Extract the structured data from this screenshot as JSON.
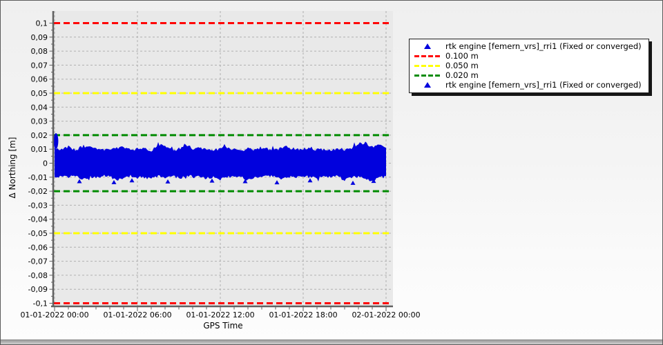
{
  "window": {
    "background_top": "#efefef",
    "background_bottom": "#fdfdfd",
    "plot_background": "#e9e9e9",
    "grid_color": "#b0b0b0",
    "axis_color": "#606060",
    "text_color": "#000000"
  },
  "chart_data": {
    "type": "scatter",
    "title": "",
    "xlabel": "GPS Time",
    "ylabel": "Δ Northing [m]",
    "grid": true,
    "legend_position": "right-top",
    "x_range_hours": [
      0,
      24
    ],
    "x_minor_tick_hours": 1,
    "x_ticks": [
      {
        "hours": 0,
        "label": "01-01-2022 00:00"
      },
      {
        "hours": 6,
        "label": "01-01-2022 06:00"
      },
      {
        "hours": 12,
        "label": "01-01-2022 12:00"
      },
      {
        "hours": 18,
        "label": "01-01-2022 18:00"
      },
      {
        "hours": 24,
        "label": "02-01-2022 00:00"
      }
    ],
    "y_min": -0.1,
    "y_max": 0.1,
    "y_tick_step": 0.01,
    "y_minor_tick_step": 0.005,
    "y_tick_labels": [
      "0,1",
      "0,09",
      "0,08",
      "0,07",
      "0,06",
      "0,05",
      "0,04",
      "0,03",
      "0,02",
      "0,01",
      "0",
      "-0,01",
      "-0,02",
      "-0,03",
      "-0,04",
      "-0,05",
      "-0,06",
      "-0,07",
      "-0,08",
      "-0,09",
      "-0,1"
    ],
    "reference_lines": [
      {
        "value": 0.1,
        "color": "#ff0000",
        "label": "0.100 m"
      },
      {
        "value": -0.1,
        "color": "#ff0000",
        "label": "0.100 m"
      },
      {
        "value": 0.05,
        "color": "#ffff00",
        "label": "0.050 m"
      },
      {
        "value": -0.05,
        "color": "#ffff00",
        "label": "0.050 m"
      },
      {
        "value": 0.02,
        "color": "#008b00",
        "label": "0.020 m"
      },
      {
        "value": -0.02,
        "color": "#008b00",
        "label": "0.020 m"
      }
    ],
    "series": [
      {
        "name": "rtk engine [femern_vrs]_rri1 (Fixed or converged)",
        "marker": "triangle",
        "color": "#0101dd",
        "band": {
          "x_start_hours": 0,
          "x_step_hours": 0.5,
          "upper": [
            0.0105,
            0.01,
            0.0118,
            0.0095,
            0.0102,
            0.0125,
            0.0108,
            0.0098,
            0.0092,
            0.0105,
            0.0112,
            0.0095,
            0.01,
            0.0108,
            0.009,
            0.0135,
            0.0115,
            0.01,
            0.0095,
            0.013,
            0.0098,
            0.011,
            0.0102,
            0.0092,
            0.0105,
            0.0112,
            0.0098,
            0.009,
            0.0104,
            0.0096,
            0.0108,
            0.01,
            0.0095,
            0.0112,
            0.0105,
            0.0098,
            0.0102,
            0.011,
            0.0095,
            0.01,
            0.0092,
            0.0105,
            0.0098,
            0.011,
            0.014,
            0.0142,
            0.0118,
            0.0125,
            0.011
          ],
          "lower": [
            -0.0105,
            -0.0095,
            -0.01,
            -0.0092,
            -0.0118,
            -0.0098,
            -0.0105,
            -0.009,
            -0.0095,
            -0.0125,
            -0.01,
            -0.0092,
            -0.0098,
            -0.0105,
            -0.011,
            -0.0095,
            -0.01,
            -0.009,
            -0.0105,
            -0.0098,
            -0.0092,
            -0.01,
            -0.0108,
            -0.0095,
            -0.0115,
            -0.0098,
            -0.0092,
            -0.01,
            -0.012,
            -0.0095,
            -0.01,
            -0.009,
            -0.0098,
            -0.011,
            -0.0095,
            -0.0102,
            -0.0092,
            -0.01,
            -0.0105,
            -0.0095,
            -0.0098,
            -0.009,
            -0.0125,
            -0.01,
            -0.0095,
            -0.0105,
            -0.013,
            -0.0098,
            -0.01
          ]
        },
        "startup_cluster": {
          "hours_center": 0.1,
          "hours_radius": 0.17,
          "value_center": 0.0158,
          "value_radius": 0.0056
        },
        "outliers": [
          [
            1.8,
            -0.0128
          ],
          [
            4.3,
            -0.0135
          ],
          [
            5.6,
            -0.0122
          ],
          [
            8.2,
            -0.013
          ],
          [
            11.4,
            -0.0124
          ],
          [
            13.8,
            -0.0128
          ],
          [
            16.1,
            -0.0136
          ],
          [
            18.5,
            -0.0122
          ],
          [
            21.6,
            -0.014
          ],
          [
            23.1,
            -0.0126
          ]
        ],
        "noise_seed": 20220101,
        "noise_amp": 0.002
      }
    ],
    "legend": [
      {
        "marker": "triangle",
        "color": "#0101dd",
        "label": "rtk engine [femern_vrs]_rri1 (Fixed or converged)"
      },
      {
        "marker": "dashes",
        "color": "#ff0000",
        "label": "0.100 m"
      },
      {
        "marker": "dashes",
        "color": "#ffff00",
        "label": "0.050 m"
      },
      {
        "marker": "dashes",
        "color": "#008b00",
        "label": "0.020 m"
      },
      {
        "marker": "triangle",
        "color": "#0101dd",
        "label": "rtk engine [femern_vrs]_rri1 (Fixed or converged)"
      }
    ]
  }
}
